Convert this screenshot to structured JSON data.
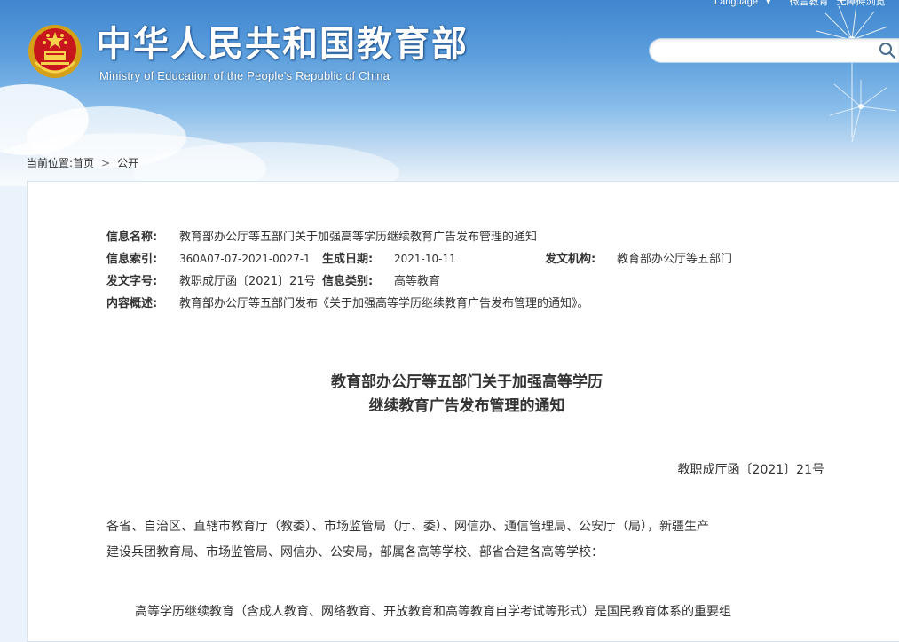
{
  "header": {
    "title": "中华人民共和国教育部",
    "subtitle": "Ministry of Education of the People's Republic of China",
    "top_links": [
      "Language",
      "▾",
      "微言教育",
      "无障碍浏览"
    ],
    "search_placeholder": "",
    "colors": {
      "sky_top": "#3f86cf",
      "title_shadow": "#1d4f8a"
    }
  },
  "breadcrumb": {
    "label": "当前位置:",
    "items": [
      "首页",
      "公开"
    ],
    "separator": ">"
  },
  "meta": {
    "name_label": "信息名称:",
    "name_value": "教育部办公厅等五部门关于加强高等学历继续教育广告发布管理的通知",
    "index_label": "信息索引:",
    "index_value": "360A07-07-2021-0027-1",
    "date_label": "生成日期:",
    "date_value": "2021-10-11",
    "org_label": "发文机构:",
    "org_value": "教育部办公厅等五部门",
    "docno_label": "发文字号:",
    "docno_value": "教职成厅函〔2021〕21号",
    "category_label": "信息类别:",
    "category_value": "高等教育",
    "summary_label": "内容概述:",
    "summary_value": "教育部办公厅等五部门发布《关于加强高等学历继续教育广告发布管理的通知》。"
  },
  "document": {
    "title_line1": "教育部办公厅等五部门关于加强高等学历",
    "title_line2": "继续教育广告发布管理的通知",
    "number": "教职成厅函〔2021〕21号",
    "addressee_line1": "各省、自治区、直辖市教育厅（教委）、市场监管局（厅、委）、网信办、通信管理局、公安厅（局），新疆生产",
    "addressee_line2": "建设兵团教育局、市场监管局、网信办、公安局，部属各高等学校、部省合建各高等学校：",
    "body_line1": "高等学历继续教育（含成人教育、网络教育、开放教育和高等教育自学考试等形式）是国民教育体系的重要组"
  }
}
